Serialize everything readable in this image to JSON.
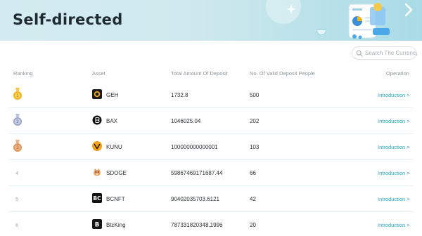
{
  "banner": {
    "title": "Self-directed"
  },
  "search": {
    "placeholder": "Search The Currency",
    "value": ""
  },
  "table": {
    "headers": {
      "ranking": "Ranking",
      "asset": "Asset",
      "total_deposit": "Total Amount Of Deposit",
      "valid_people": "No. Of Valid Deposit People",
      "operation": "Operation"
    },
    "rows": [
      {
        "rank": "1",
        "rank_display": "",
        "medal": "gold-medal-icon",
        "icon": "geh-coin-icon",
        "asset": "GEH",
        "total_deposit": "1732.8",
        "valid_people": "500",
        "operation": "Introduction >"
      },
      {
        "rank": "2",
        "rank_display": "",
        "medal": "silver-medal-icon",
        "icon": "bax-coin-icon",
        "asset": "BAX",
        "total_deposit": "1046025.04",
        "valid_people": "202",
        "operation": "Introduction >"
      },
      {
        "rank": "3",
        "rank_display": "",
        "medal": "bronze-medal-icon",
        "icon": "kunu-coin-icon",
        "asset": "KUNU",
        "total_deposit": "100000000000001",
        "valid_people": "103",
        "operation": "Introduction >"
      },
      {
        "rank": "4",
        "rank_display": "4",
        "medal": "",
        "icon": "sdoge-coin-icon",
        "asset": "SDOGE",
        "total_deposit": "59867469171687.44",
        "valid_people": "66",
        "operation": "Introduction >"
      },
      {
        "rank": "5",
        "rank_display": "5",
        "medal": "",
        "icon": "bcnft-coin-icon",
        "asset": "BCNFT",
        "total_deposit": "90402035703.6121",
        "valid_people": "42",
        "operation": "Introduction >"
      },
      {
        "rank": "6",
        "rank_display": "6",
        "medal": "",
        "icon": "btcking-coin-icon",
        "asset": "BtcKing",
        "total_deposit": "787331820348.1996",
        "valid_people": "20",
        "operation": "Introduction >"
      }
    ]
  },
  "colors": {
    "accent": "#2aa4bd",
    "banner_start": "#d4ecf1",
    "banner_end": "#a9dbe6",
    "gold": "#f2b31c",
    "silver": "#9aa7c7",
    "bronze": "#e0955a"
  }
}
